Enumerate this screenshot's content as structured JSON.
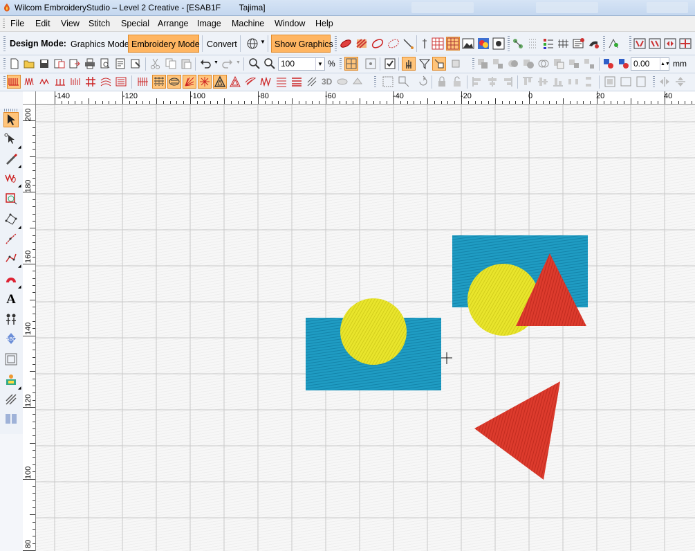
{
  "window": {
    "title": "Wilcom EmbroideryStudio – Level 2 Creative - [ESAB1F        Tajima]"
  },
  "menu": [
    "File",
    "Edit",
    "View",
    "Stitch",
    "Special",
    "Arrange",
    "Image",
    "Machine",
    "Window",
    "Help"
  ],
  "toolbar": {
    "design_mode_label": "Design Mode:",
    "graphics_mode_label": "Graphics Mode",
    "embroidery_mode_label": "Embroidery Mode",
    "convert_label": "Convert",
    "show_graphics_label": "Show Graphics",
    "zoom_value": "100",
    "zoom_unit": "%",
    "angle_value": "0.00",
    "angle_unit": "mm"
  },
  "status": {
    "active_mode": "Embroidery Mode"
  },
  "ruler": {
    "horizontal": [
      "-140",
      "-120",
      "-100",
      "-80",
      "-60",
      "-40",
      "-20",
      "0",
      "20",
      "40"
    ],
    "vertical": [
      "200",
      "180",
      "160",
      "140",
      "120",
      "100",
      "80"
    ]
  },
  "design_objects": [
    {
      "type": "rectangle",
      "fill": "blue",
      "color": "#1e9ec4"
    },
    {
      "type": "circle",
      "fill": "yellow",
      "color": "#e8e52a"
    },
    {
      "type": "rectangle",
      "fill": "blue",
      "color": "#1e9ec4"
    },
    {
      "type": "circle",
      "fill": "yellow",
      "color": "#e8e52a"
    },
    {
      "type": "triangle",
      "fill": "red",
      "color": "#dd3a2c"
    },
    {
      "type": "triangle",
      "fill": "red",
      "color": "#dd3a2c"
    }
  ],
  "colors": {
    "accent_on": "#ffb561",
    "toolbar_bg": "#eef2f8",
    "grid": "#c8c8c8"
  }
}
